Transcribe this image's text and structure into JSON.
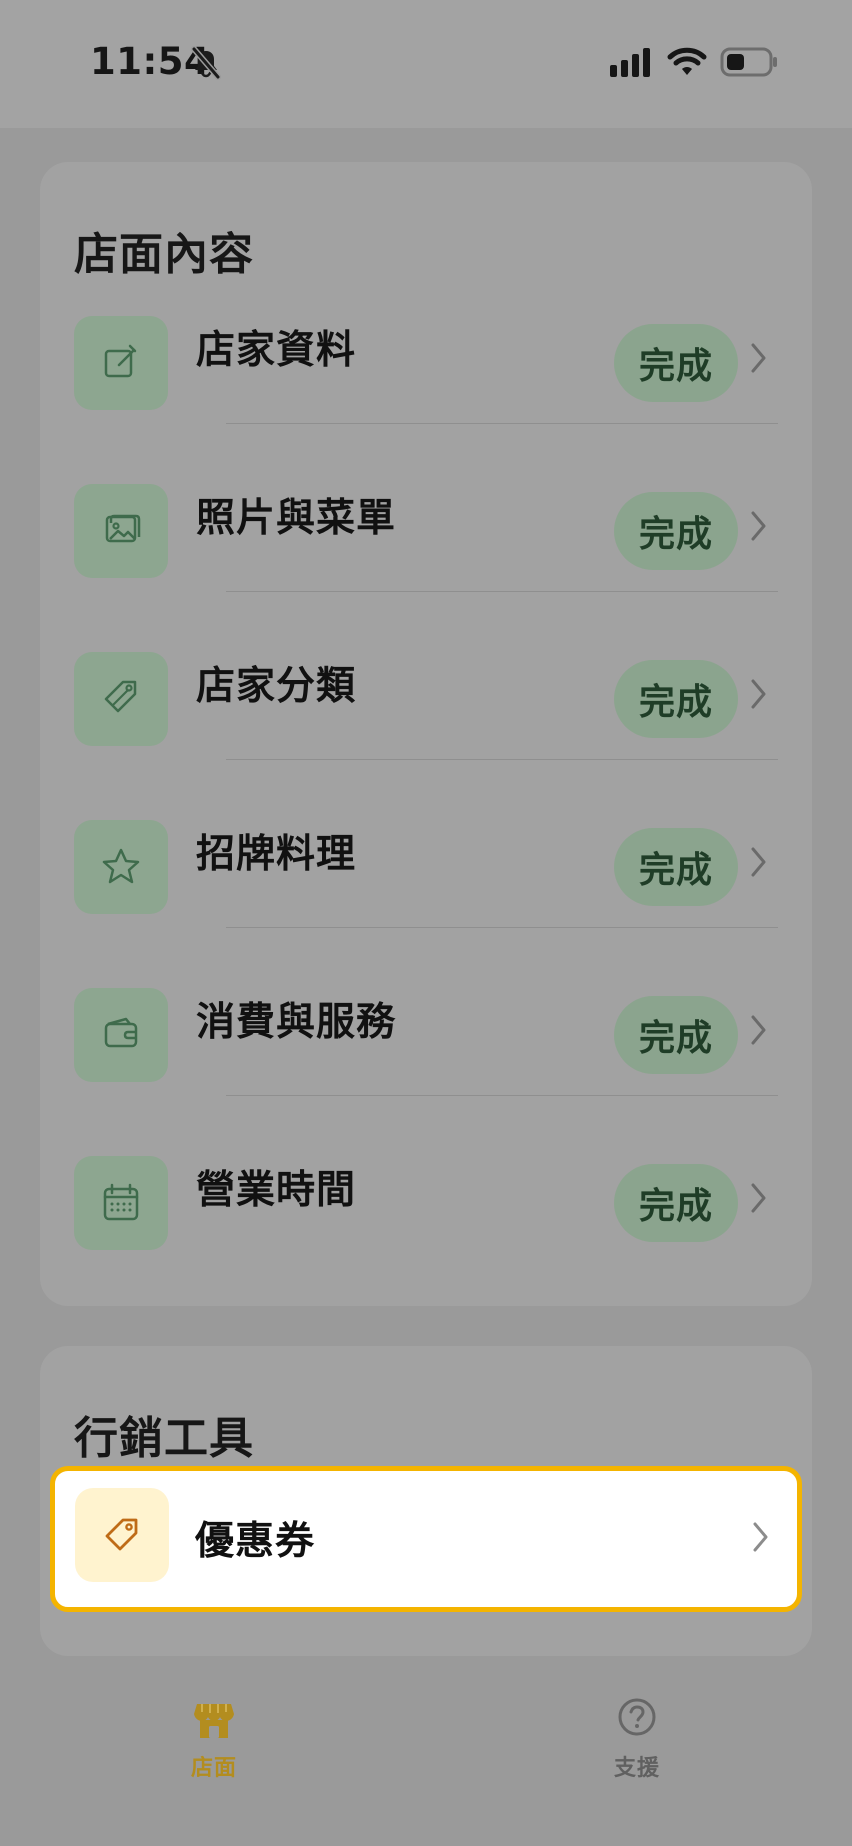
{
  "status_bar": {
    "time": "11:54",
    "bell_icon": "bell-slash-icon",
    "signal_icon": "signal-bars-icon",
    "wifi_icon": "wifi-icon",
    "battery_icon": "battery-icon"
  },
  "store_content": {
    "title": "店面內容",
    "items": [
      {
        "label": "店家資料",
        "status": "完成",
        "icon": "edit-icon"
      },
      {
        "label": "照片與菜單",
        "status": "完成",
        "icon": "image-icon"
      },
      {
        "label": "店家分類",
        "status": "完成",
        "icon": "tag-icon"
      },
      {
        "label": "招牌料理",
        "status": "完成",
        "icon": "star-icon"
      },
      {
        "label": "消費與服務",
        "status": "完成",
        "icon": "wallet-icon"
      },
      {
        "label": "營業時間",
        "status": "完成",
        "icon": "calendar-icon"
      }
    ]
  },
  "marketing_tools": {
    "title": "行銷工具",
    "items": [
      {
        "label": "優惠券",
        "icon": "coupon-tag-icon"
      }
    ]
  },
  "bottom_nav": {
    "items": [
      {
        "label": "店面",
        "icon": "store-icon",
        "active": true
      },
      {
        "label": "支援",
        "icon": "help-icon",
        "active": false
      }
    ]
  },
  "colors": {
    "background": "#9a9a9a",
    "card": "#a2a2a2",
    "green_tint": "#8da690",
    "green_text": "#1f3d27",
    "highlight_border": "#f4b400",
    "coupon_icon_bg": "#fff3cf",
    "active_nav": "#b38d1f"
  }
}
